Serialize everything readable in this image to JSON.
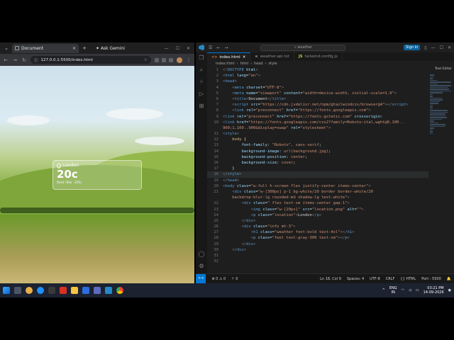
{
  "browser": {
    "tab_title": "Document",
    "new_tab": "+",
    "ask_gemini": "Ask Gemini",
    "url": "127.0.0.1:5500/index.html"
  },
  "weather_card": {
    "location": "London",
    "temperature": "20c",
    "feels_like": "feel like -20c"
  },
  "vscode": {
    "search_text": "weather",
    "sign_in": "Sign In",
    "tabs": [
      {
        "label": "index.html",
        "icon": "html-icon",
        "active": true
      },
      {
        "label": "weather.api.txt",
        "icon": "text-icon",
        "active": false
      },
      {
        "label": "tailwind.config.js",
        "icon": "js-icon",
        "active": false
      }
    ],
    "breadcrumbs": [
      "index.html",
      "html",
      "head",
      "style"
    ],
    "minimap_label": "Text Editor",
    "status": {
      "remote": "><",
      "problems": "⊗ 0 ⚠ 0",
      "ports": "⚐ 0",
      "position": "Ln 18, Col 9",
      "spaces": "Spaces: 4",
      "encoding": "UTF-8",
      "eol": "CRLF",
      "language": "{} HTML",
      "port": "Port : 5500"
    },
    "code_lines": [
      {
        "n": "1",
        "html": "<span class='p'>&lt;!</span><span class='t'>DOCTYPE</span> <span class='a'>html</span><span class='p'>&gt;</span>"
      },
      {
        "n": "2",
        "html": "<span class='p'>&lt;</span><span class='t'>html</span> <span class='a'>lang</span>=<span class='s'>\"en\"</span><span class='p'>&gt;</span>"
      },
      {
        "n": "3",
        "html": "<span class='p'>&lt;</span><span class='t'>head</span><span class='p'>&gt;</span>"
      },
      {
        "n": "4",
        "html": "    <span class='p'>&lt;</span><span class='t'>meta</span> <span class='a'>charset</span>=<span class='s'>\"UTF-8\"</span><span class='p'>&gt;</span>"
      },
      {
        "n": "5",
        "html": "    <span class='p'>&lt;</span><span class='t'>meta</span> <span class='a'>name</span>=<span class='s'>\"viewport\"</span> <span class='a'>content</span>=<span class='s'>\"width=device-width, initial-scale=1.0\"</span><span class='p'>&gt;</span>"
      },
      {
        "n": "6",
        "html": "    <span class='p'>&lt;</span><span class='t'>title</span><span class='p'>&gt;</span>Document<span class='p'>&lt;/</span><span class='t'>title</span><span class='p'>&gt;</span>"
      },
      {
        "n": "7",
        "html": "    <span class='p'>&lt;</span><span class='t'>script</span> <span class='a'>src</span>=<span class='s'>\"https://cdn.jsdelivr.net/npm/@tailwindcss/browser@4\"</span><span class='p'>&gt;&lt;/</span><span class='t'>script</span><span class='p'>&gt;</span>"
      },
      {
        "n": "8",
        "html": "    <span class='p'>&lt;</span><span class='t'>link</span> <span class='a'>rel</span>=<span class='s'>\"preconnect\"</span> <span class='a'>href</span>=<span class='s'>\"https://fonts.googleapis.com\"</span><span class='p'>&gt;</span>"
      },
      {
        "n": "9",
        "html": "<span class='p'>&lt;</span><span class='t'>link</span> <span class='a'>rel</span>=<span class='s'>\"preconnect\"</span> <span class='a'>href</span>=<span class='s'>\"https://fonts.gstatic.com\"</span> <span class='a'>crossorigin</span><span class='p'>&gt;</span>"
      },
      {
        "n": "10",
        "html": "<span class='p'>&lt;</span><span class='t'>link</span> <span class='a'>href</span>=<span class='s'>\"https://fonts.googleapis.com/css2?family=Roboto:ital,wght@0,100..</span>"
      },
      {
        "n": "",
        "html": "<span class='s'>900;1,100..900&amp;display=swap\"</span> <span class='a'>rel</span>=<span class='s'>\"stylesheet\"</span><span class='p'>&gt;</span>"
      },
      {
        "n": "11",
        "html": "<span class='p'>&lt;</span><span class='t'>style</span><span class='p'>&gt;</span>"
      },
      {
        "n": "12",
        "html": "    <span class='sel'>body</span> {"
      },
      {
        "n": "13",
        "html": "        <span class='pr'>font-family</span>: <span class='v'>\"Roboto\", sans-serif</span>;"
      },
      {
        "n": "14",
        "html": "        <span class='pr'>background-image</span>: <span class='v'>url(background.jpg)</span>;"
      },
      {
        "n": "15",
        "html": "        <span class='pr'>background-position</span>: <span class='v'>center</span>;"
      },
      {
        "n": "16",
        "html": "        <span class='pr'>background-size</span>: <span class='v'>cover</span>;"
      },
      {
        "n": "17",
        "html": "    }"
      },
      {
        "n": "18",
        "html": "<span class='p'>&lt;/</span><span class='t'>style</span><span class='p'>&gt;</span>",
        "current": true
      },
      {
        "n": "19",
        "html": "<span class='p'>&lt;/</span><span class='t'>head</span><span class='p'>&gt;</span>"
      },
      {
        "n": "20",
        "html": "<span class='p'>&lt;</span><span class='t'>body</span> <span class='a'>class</span>=<span class='s'>\"w-full h-screen flex justify-center items-center\"</span><span class='p'>&gt;</span>"
      },
      {
        "n": "21",
        "html": "    <span class='p'>&lt;</span><span class='t'>div</span> <span class='a'>class</span>=<span class='s'>\"w-[300px] p-1 bg-white/20 border border-white/20</span>"
      },
      {
        "n": "",
        "html": "<span class='s'>    backdrop-blur-lg rounded-md shadow-lg text-white\"</span><span class='p'>&gt;</span>"
      },
      {
        "n": "22",
        "html": "        <span class='p'>&lt;</span><span class='t'>div</span> <span class='a'>class</span>=<span class='s'>\" flex text-sm items-center gap-1\"</span><span class='p'>&gt;</span>"
      },
      {
        "n": "23",
        "html": "            <span class='p'>&lt;</span><span class='t'>img</span> <span class='a'>class</span>=<span class='s'>\"w-[20px]\"</span> <span class='a'>src</span>=<span class='s'>\"location.png\"</span> <span class='a'>alt</span>=<span class='s'>\"\"</span><span class='p'>&gt;</span>"
      },
      {
        "n": "24",
        "html": "            <span class='p'>&lt;</span><span class='t'>p</span> <span class='a'>class</span>=<span class='s'>\"location\"</span><span class='p'>&gt;</span>London<span class='p'>&lt;/</span><span class='t'>p</span><span class='p'>&gt;</span>"
      },
      {
        "n": "25",
        "html": "        <span class='p'>&lt;/</span><span class='t'>div</span><span class='p'>&gt;</span>"
      },
      {
        "n": "26",
        "html": "        <span class='p'>&lt;</span><span class='t'>div</span> <span class='a'>class</span>=<span class='s'>\"info mt-3\"</span><span class='p'>&gt;</span>"
      },
      {
        "n": "27",
        "html": "            <span class='p'>&lt;</span><span class='t'>h1</span> <span class='a'>class</span>=<span class='s'>\"weather font-bold text-4xl\"</span><span class='p'>&gt;&lt;/</span><span class='t'>h1</span><span class='p'>&gt;</span>"
      },
      {
        "n": "28",
        "html": "            <span class='p'>&lt;</span><span class='t'>p</span> <span class='a'>class</span>=<span class='s'>\"feel text-gray-300 text-sm\"</span><span class='p'>&gt;&lt;/</span><span class='t'>p</span><span class='p'>&gt;</span>"
      },
      {
        "n": "29",
        "html": "        <span class='p'>&lt;/</span><span class='t'>div</span><span class='p'>&gt;</span>"
      },
      {
        "n": "30",
        "html": "    <span class='p'>&lt;/</span><span class='t'>div</span><span class='p'>&gt;</span>"
      },
      {
        "n": "31",
        "html": ""
      },
      {
        "n": "32",
        "html": ""
      }
    ]
  },
  "taskbar": {
    "lang_top": "ENG",
    "lang_bottom": "IN",
    "time": "03:21 PM",
    "date": "14-09-2026"
  }
}
